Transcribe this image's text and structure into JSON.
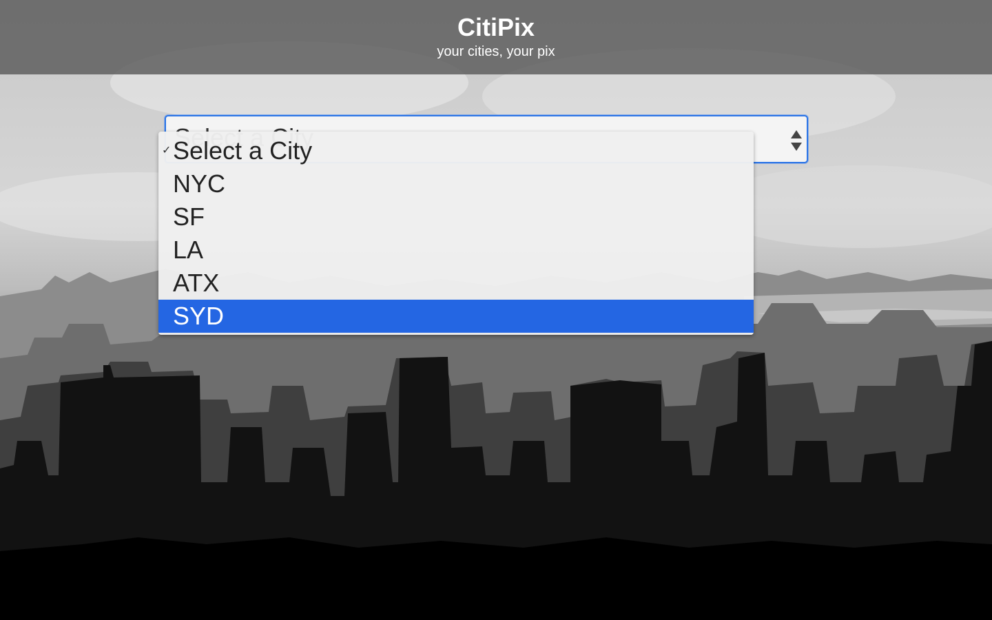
{
  "header": {
    "title": "CitiPix",
    "subtitle": "your cities, your pix"
  },
  "city_select": {
    "value": "Select a City",
    "checked_option": "Select a City",
    "highlighted_option": "SYD",
    "options": [
      "Select a City",
      "NYC",
      "SF",
      "LA",
      "ATX",
      "SYD"
    ]
  },
  "icons": {
    "checkmark": "checkmark-icon",
    "stepper": "up-down-arrows-icon"
  },
  "colors": {
    "accent": "#2466e3",
    "header_bg": "#5a5a5a",
    "header_text": "#ffffff"
  }
}
